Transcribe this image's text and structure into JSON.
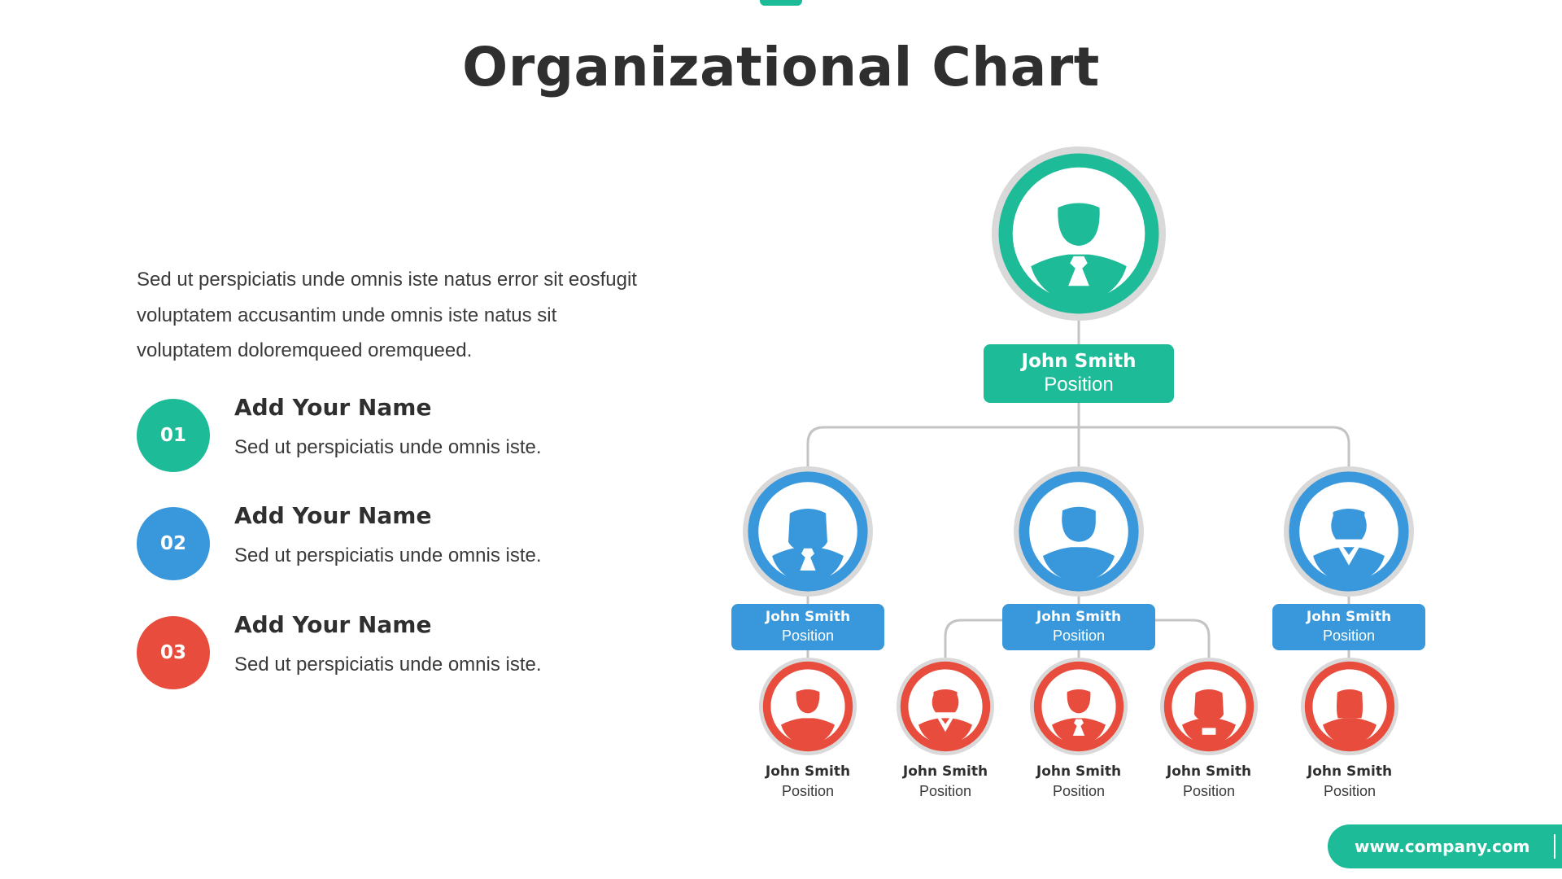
{
  "title": "Organizational Chart",
  "colors": {
    "green": "#1dbb98",
    "blue": "#3898db",
    "red": "#e84c3d",
    "ring": "#d9d9d9",
    "connector": "#c4c4c4",
    "text_dark": "#2f2f2f"
  },
  "intro": "Sed ut perspiciatis unde omnis iste natus error sit eosfugit voluptatem accusantim unde omnis iste natus sit voluptatem doloremqueed oremqueed.",
  "items": [
    {
      "number": "01",
      "heading": "Add Your Name",
      "text": "Sed ut perspiciatis unde omnis iste.",
      "color": "#1dbb98"
    },
    {
      "number": "02",
      "heading": "Add Your Name",
      "text": "Sed ut perspiciatis unde omnis iste.",
      "color": "#3898db"
    },
    {
      "number": "03",
      "heading": "Add Your Name",
      "text": "Sed ut perspiciatis unde omnis iste.",
      "color": "#e84c3d"
    }
  ],
  "org": {
    "root": {
      "name": "John Smith",
      "position": "Position",
      "avatar": "man-tie-icon"
    },
    "managers": [
      {
        "name": "John Smith",
        "position": "Position",
        "avatar": "woman-tie-icon"
      },
      {
        "name": "John Smith",
        "position": "Position",
        "avatar": "man-spiky-hair-icon"
      },
      {
        "name": "John Smith",
        "position": "Position",
        "avatar": "woman-collar-icon"
      }
    ],
    "staff": [
      {
        "name": "John Smith",
        "position": "Position",
        "avatar": "man-icon",
        "manager": 0
      },
      {
        "name": "John Smith",
        "position": "Position",
        "avatar": "woman-collar-icon",
        "manager": 1
      },
      {
        "name": "John Smith",
        "position": "Position",
        "avatar": "man-tie-icon",
        "manager": 1
      },
      {
        "name": "John Smith",
        "position": "Position",
        "avatar": "woman-long-hair-icon",
        "manager": 1
      },
      {
        "name": "John Smith",
        "position": "Position",
        "avatar": "woman-icon",
        "manager": 2
      }
    ]
  },
  "footer": {
    "url": "www.company.com"
  }
}
